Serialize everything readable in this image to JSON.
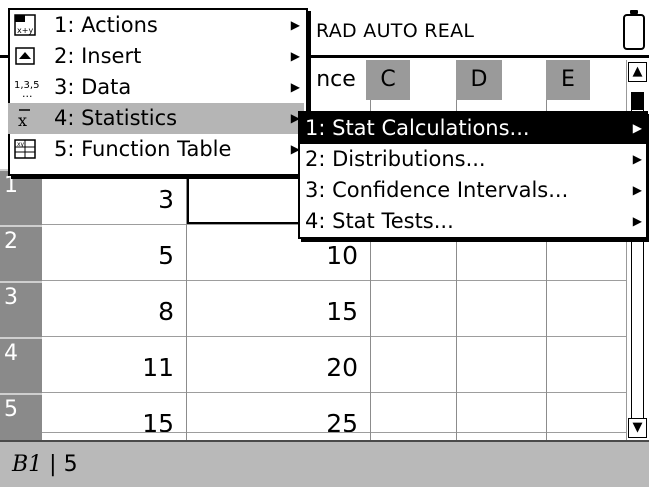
{
  "status": {
    "text": "RAD AUTO REAL"
  },
  "columns": {
    "b_partial": "nce",
    "c": "C",
    "d": "D",
    "e": "E"
  },
  "rows": [
    {
      "num": "1",
      "a": "3",
      "b": ""
    },
    {
      "num": "2",
      "a": "5",
      "b": "10"
    },
    {
      "num": "3",
      "a": "8",
      "b": "15"
    },
    {
      "num": "4",
      "a": "11",
      "b": "20"
    },
    {
      "num": "5",
      "a": "15",
      "b": "25"
    }
  ],
  "entry_line": {
    "cell": "B1",
    "separator": "|",
    "value": "5"
  },
  "menu": {
    "items": [
      {
        "label": "1: Actions"
      },
      {
        "label": "2: Insert"
      },
      {
        "label": "3: Data"
      },
      {
        "label": "4: Statistics"
      },
      {
        "label": "5: Function Table"
      }
    ],
    "selected_index": 3
  },
  "submenu": {
    "items": [
      {
        "label": "1: Stat Calculations..."
      },
      {
        "label": "2: Distributions..."
      },
      {
        "label": "3: Confidence Intervals..."
      },
      {
        "label": "4: Stat Tests..."
      }
    ],
    "selected_index": 0
  },
  "icons": {
    "actions": "actions-icon",
    "insert": "insert-icon",
    "data": "data-icon",
    "statistics": "statistics-icon",
    "function_table": "function-table-icon"
  }
}
